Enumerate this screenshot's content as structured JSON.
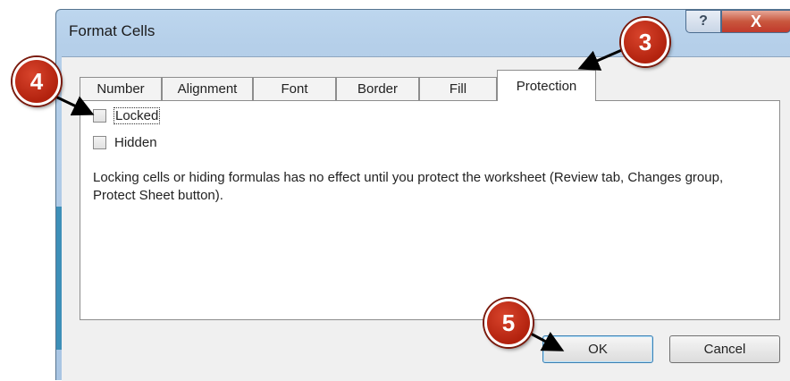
{
  "dialog": {
    "title": "Format Cells",
    "help_glyph": "?",
    "close_glyph": "X"
  },
  "tabs": [
    {
      "label": "Number"
    },
    {
      "label": "Alignment"
    },
    {
      "label": "Font"
    },
    {
      "label": "Border"
    },
    {
      "label": "Fill"
    },
    {
      "label": "Protection",
      "active": true
    }
  ],
  "options": {
    "locked": {
      "label": "Locked",
      "checked": false
    },
    "hidden": {
      "label": "Hidden",
      "checked": false
    }
  },
  "description": "Locking cells or hiding formulas has no effect until you protect the worksheet (Review tab, Changes group, Protect Sheet button).",
  "buttons": {
    "ok": "OK",
    "cancel": "Cancel"
  },
  "callouts": {
    "tab_step": "3",
    "checkbox_step": "4",
    "ok_step": "5"
  },
  "colors": {
    "callout": "#c2301a",
    "close_button": "#c9573e"
  }
}
